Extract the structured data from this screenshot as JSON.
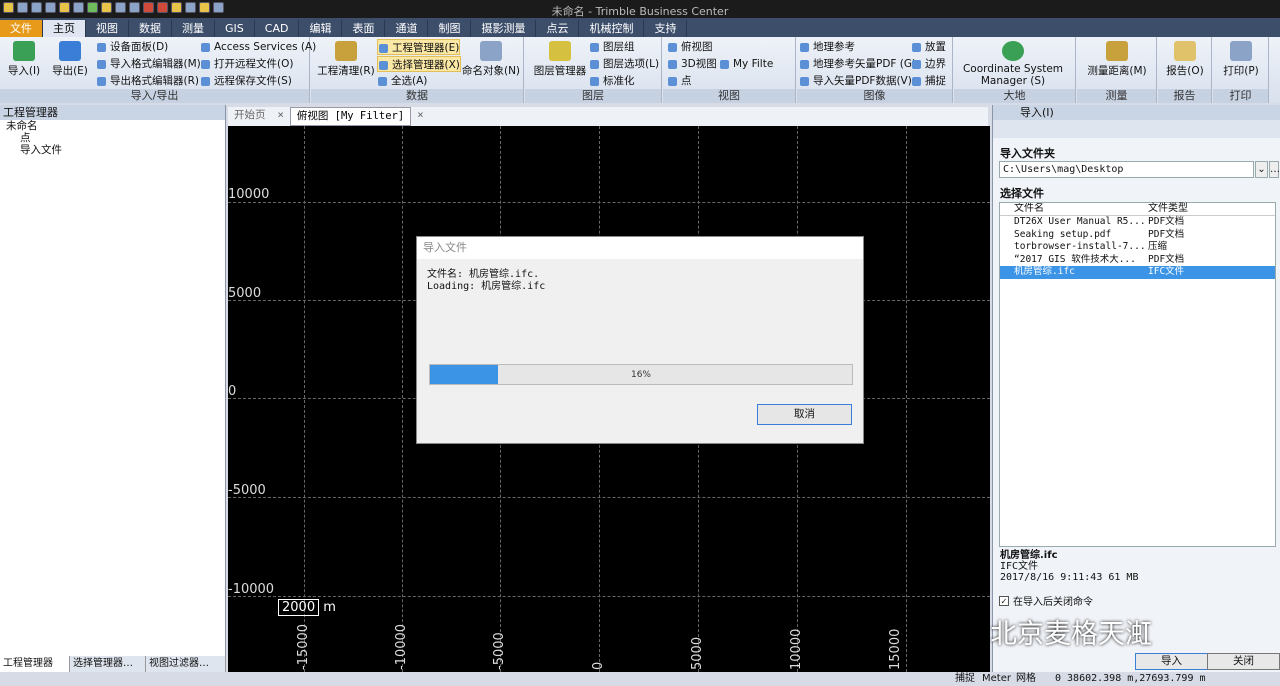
{
  "window": {
    "title": "未命名 - Trimble Business Center"
  },
  "tabs": [
    "文件",
    "主页",
    "视图",
    "数据",
    "测量",
    "GIS",
    "CAD",
    "编辑",
    "表面",
    "通道",
    "制图",
    "摄影测量",
    "点云",
    "机械控制",
    "支持"
  ],
  "ribbon": {
    "import_export": {
      "label": "导入/导出",
      "import": "导入(I)",
      "export": "导出(E)",
      "device_panel": "设备面板(D)",
      "import_format_editor": "导入格式编辑器(M)",
      "export_format_editor": "导出格式编辑器(R)",
      "access_services": "Access Services (A)",
      "open_remote": "打开远程文件(O)",
      "remote_save": "远程保存文件(S)"
    },
    "data": {
      "label": "数据",
      "project_cleanup": "工程清理(R)",
      "project_manager": "工程管理器(E)",
      "selection_manager": "选择管理器(X)",
      "select_all": "全选(A)",
      "name_object": "命名对象(N)"
    },
    "layers": {
      "label": "图层",
      "layer_manager": "图层管理器",
      "layer_group": "图层组",
      "layer_options": "图层选项(L)",
      "standardize": "标准化"
    },
    "view": {
      "label": "视图",
      "plan_view": "俯视图",
      "view_3d": "3D视图",
      "filter": "My Filte",
      "point": "点"
    },
    "image": {
      "label": "图像",
      "georef": "地理参考",
      "georef_pdf": "地理参考矢量PDF (G)",
      "import_pdf": "导入矢量PDF数据(V)",
      "place": "放置",
      "boundary": "边界",
      "snap": "捕捉"
    },
    "earth": {
      "label": "大地",
      "coord_sys": "Coordinate System Manager (S)"
    },
    "survey": {
      "label": "测量",
      "distance": "测量距离(M)"
    },
    "report": {
      "label": "报告",
      "report": "报告(O)"
    },
    "print": {
      "label": "打印",
      "print": "打印(P)"
    }
  },
  "left_panel": {
    "title": "工程管理器",
    "tree": [
      "未命名",
      "点",
      "导入文件"
    ],
    "tabs": [
      "工程管理器",
      "选择管理器…",
      "视图过滤器…"
    ]
  },
  "doc_tabs": [
    "开始页",
    "俯视图 [My Filter]"
  ],
  "canvas": {
    "y_labels": [
      "10000",
      "5000",
      "0",
      "-5000",
      "-10000"
    ],
    "x_labels": [
      "-15000",
      "-10000",
      "-5000",
      "0",
      "5000",
      "10000",
      "15000"
    ],
    "scale_value": "2000",
    "scale_unit": "m"
  },
  "dialog": {
    "title": "导入文件",
    "line1": "文件名: 机房管综.ifc.",
    "line2": "Loading: 机房管综.ifc",
    "progress": 0.16,
    "progress_text": "16%",
    "cancel": "取消"
  },
  "right_panel": {
    "title": "导入(I)",
    "folder_label": "导入文件夹",
    "folder": "C:\\Users\\mag\\Desktop",
    "files_label": "选择文件",
    "col_name": "文件名",
    "col_type": "文件类型",
    "files": [
      {
        "name": "DT26X User Manual R5....",
        "type": "PDF文档"
      },
      {
        "name": "Seaking setup.pdf",
        "type": "PDF文档"
      },
      {
        "name": "torbrowser-install-7....",
        "type": "压缩"
      },
      {
        "name": "“2017 GIS 软件技术大...",
        "type": "PDF文档"
      },
      {
        "name": "机房管综.ifc",
        "type": "IFC文件"
      }
    ],
    "sel_name": "机房管综.ifc",
    "sel_type": "IFC文件",
    "sel_meta": "2017/8/16 9:11:43   61 MB",
    "close_after": "在导入后关闭命令",
    "import_btn": "导入",
    "close_btn": "关闭"
  },
  "status": {
    "snap": "捕捉",
    "unit": "Meter",
    "grid": "网格",
    "coords": "0  38602.398 m,27693.799 m"
  },
  "watermark": "北京麦格天渱"
}
